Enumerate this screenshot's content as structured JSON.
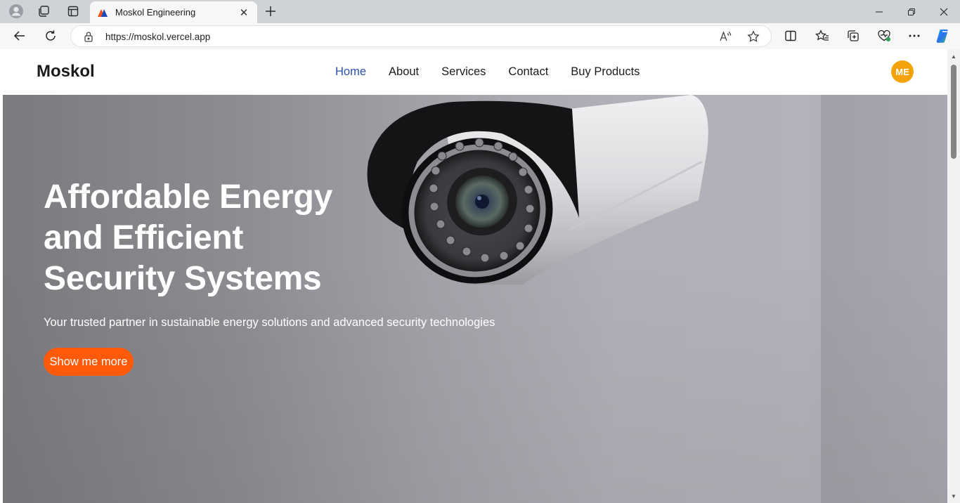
{
  "browser": {
    "tab_title": "Moskol Engineering",
    "tab_close": "✕",
    "new_tab": "+",
    "url": "https://moskol.vercel.app"
  },
  "site": {
    "brand": "Moskol",
    "nav": [
      {
        "label": "Home",
        "active": true
      },
      {
        "label": "About"
      },
      {
        "label": "Services"
      },
      {
        "label": "Contact"
      },
      {
        "label": "Buy Products"
      }
    ],
    "avatar_initials": "ME"
  },
  "hero": {
    "title_line1": "Affordable Energy",
    "title_line2": "and Efficient",
    "title_line3": "Security Systems",
    "subtitle": "Your trusted partner in sustainable energy solutions and advanced security technologies",
    "cta_label": "Show me more"
  },
  "colors": {
    "accent": "#ff5a0a",
    "nav_active": "#2b4fb0",
    "avatar": "#f4a40a"
  },
  "icons": {
    "profile": "profile-icon",
    "workspaces": "workspaces-icon",
    "tab_actions": "tab-actions-icon",
    "back": "back-arrow-icon",
    "refresh": "refresh-icon",
    "lock": "lock-icon",
    "read_aloud": "read-aloud-icon",
    "favorite": "star-icon",
    "split": "split-screen-icon",
    "favorites": "favorites-icon",
    "collections": "collections-icon",
    "health": "browser-essentials-icon",
    "more": "more-icon",
    "copilot": "copilot-icon"
  }
}
